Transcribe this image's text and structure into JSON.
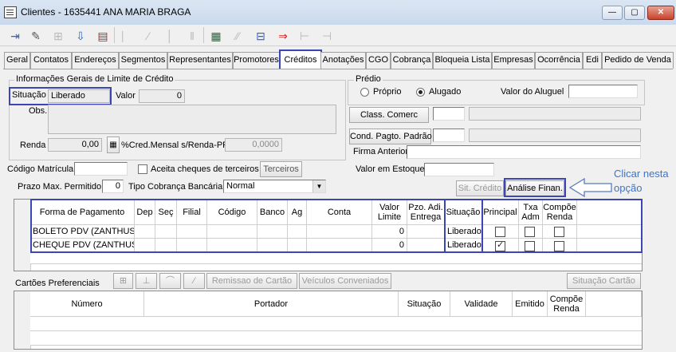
{
  "window": {
    "title": "Clientes - 1635441 ANA MARIA BRAGA",
    "min": "—",
    "max": "▢",
    "close": "✕"
  },
  "tabs": [
    "Geral",
    "Contatos",
    "Endereços",
    "Segmentos",
    "Representantes",
    "Promotores",
    "Créditos",
    "Anotações",
    "CGO",
    "Cobrança",
    "Bloqueia Lista",
    "Empresas",
    "Ocorrência",
    "Edi",
    "Pedido de Venda"
  ],
  "active_tab": "Créditos",
  "credit_info": {
    "group_label": "Informações Gerais de Limite de Crédito",
    "situacao_label": "Situação",
    "situacao_value": "Liberado",
    "valor_label": "Valor",
    "valor_value": "0",
    "obs_label": "Obs.",
    "renda_label": "Renda",
    "renda_value": "0,00",
    "cred_mensal_label": "%Cred.Mensal s/Renda-PF",
    "cred_mensal_value": "0,0000"
  },
  "predio": {
    "group_label": "Prédio",
    "proprio": "Próprio",
    "alugado": "Alugado",
    "valor_aluguel_label": "Valor do Aluguel"
  },
  "right_fields": {
    "class_comerc": "Class. Comerc",
    "cond_pagto": "Cond. Pagto. Padrão",
    "firma_anterior": "Firma Anterior",
    "valor_estoque": "Valor em Estoque"
  },
  "misc": {
    "codigo_matricula": "Código Matrícula",
    "aceita_cheques": "Aceita cheques de terceiros",
    "terceiros_button": "Terceiros",
    "prazo_max": "Prazo Max. Permitido",
    "prazo_value": "0",
    "tipo_cobranca": "Tipo Cobrança Bancária",
    "tipo_cobranca_value": "Normal",
    "sit_credito_button": "Sit. Crédito",
    "analise_button": "Análise Finan.",
    "annotation": "Clicar nesta opção"
  },
  "payment_grid": {
    "headers": [
      "Forma de Pagamento",
      "Dep",
      "Seç",
      "Filial",
      "Código",
      "Banco",
      "Ag",
      "Conta",
      "Valor Limite",
      "Pzo. Adi. Entrega",
      "Situação",
      "Principal",
      "Txa Adm",
      "Compõe Renda"
    ],
    "rows": [
      {
        "forma": "BOLETO PDV (ZANTHUS",
        "valor_limite": "0",
        "situacao": "Liberado",
        "principal": false,
        "txa_adm": false,
        "compoe_renda": false
      },
      {
        "forma": "CHEQUE PDV (ZANTHUS",
        "valor_limite": "0",
        "situacao": "Liberado",
        "principal": true,
        "txa_adm": false,
        "compoe_renda": false
      }
    ]
  },
  "cartoes": {
    "label": "Cartões Preferenciais",
    "remissao_button": "Remissao de Cartão",
    "veiculos_button": "Veículos Conveniados",
    "situacao_button": "Situação Cartão",
    "headers": [
      "Número",
      "Portador",
      "Situação",
      "Validade",
      "Emitido",
      "Compõe Renda"
    ]
  },
  "colors": {
    "highlight": "#3b46b4",
    "annotation": "#3f73c9"
  }
}
